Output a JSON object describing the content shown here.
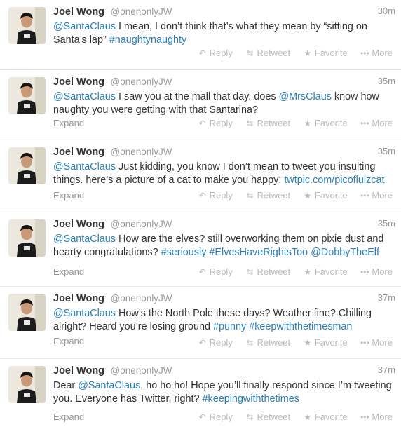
{
  "actions": {
    "reply": "Reply",
    "retweet": "Retweet",
    "favorite": "Favorite",
    "more": "More",
    "expand": "Expand"
  },
  "tweets": [
    {
      "name": "Joel Wong",
      "handle": "@onenonlyJW",
      "time": "30m",
      "segments": [
        {
          "t": "@SantaClaus",
          "link": true
        },
        {
          "t": " I mean, I don’t think that’s what they mean by “sitting on Santa’s lap” "
        },
        {
          "t": "#naughtynaughty",
          "link": true
        }
      ],
      "has_expand": false
    },
    {
      "name": "Joel Wong",
      "handle": "@onenonlyJW",
      "time": "35m",
      "segments": [
        {
          "t": "@SantaClaus",
          "link": true
        },
        {
          "t": " I saw you at the mall that day. does "
        },
        {
          "t": "@MrsClaus",
          "link": true
        },
        {
          "t": " know how naughty you were getting with that Santarina?"
        }
      ],
      "has_expand": true
    },
    {
      "name": "Joel Wong",
      "handle": "@onenonlyJW",
      "time": "35m",
      "segments": [
        {
          "t": "@SantaClaus",
          "link": true
        },
        {
          "t": " Just kidding, you know I don’t mean to tweet you insulting things. here’s a picture of a cat to make you happy: "
        },
        {
          "t": "twtpic.com/picoflulzcat",
          "link": true
        }
      ],
      "has_expand": true
    },
    {
      "name": "Joel Wong",
      "handle": "@onenonlyJW",
      "time": "35m",
      "segments": [
        {
          "t": "@SantaClaus",
          "link": true
        },
        {
          "t": " How are the elves? still overworking them on pixie dust and hearty congratulations? "
        },
        {
          "t": "#seriously",
          "link": true
        },
        {
          "t": " "
        },
        {
          "t": "#ElvesHaveRightsToo",
          "link": true
        },
        {
          "t": " "
        },
        {
          "t": "@DobbyTheElf",
          "link": true
        }
      ],
      "has_expand": true
    },
    {
      "name": "Joel Wong",
      "handle": "@onenonlyJW",
      "time": "37m",
      "segments": [
        {
          "t": "@SantaClaus",
          "link": true
        },
        {
          "t": " How’s the North Pole these days? Weather fine? Chilling alright? Heard you’re losing ground "
        },
        {
          "t": "#punny",
          "link": true
        },
        {
          "t": " "
        },
        {
          "t": "#keepwiththetimesman",
          "link": true
        }
      ],
      "has_expand": true
    },
    {
      "name": "Joel Wong",
      "handle": "@onenonlyJW",
      "time": "37m",
      "segments": [
        {
          "t": "Dear "
        },
        {
          "t": "@SantaClaus",
          "link": true
        },
        {
          "t": ", ho ho ho! Hope you’ll finally respond since I’m tweeting you. Everyone has Twitter, right? "
        },
        {
          "t": "#keepingwiththetimes",
          "link": true
        }
      ],
      "has_expand": true
    }
  ],
  "colors": {
    "link": "#2a7fb8",
    "muted": "#999999",
    "action": "#bbbbbb",
    "divider": "#e8e8e8"
  }
}
